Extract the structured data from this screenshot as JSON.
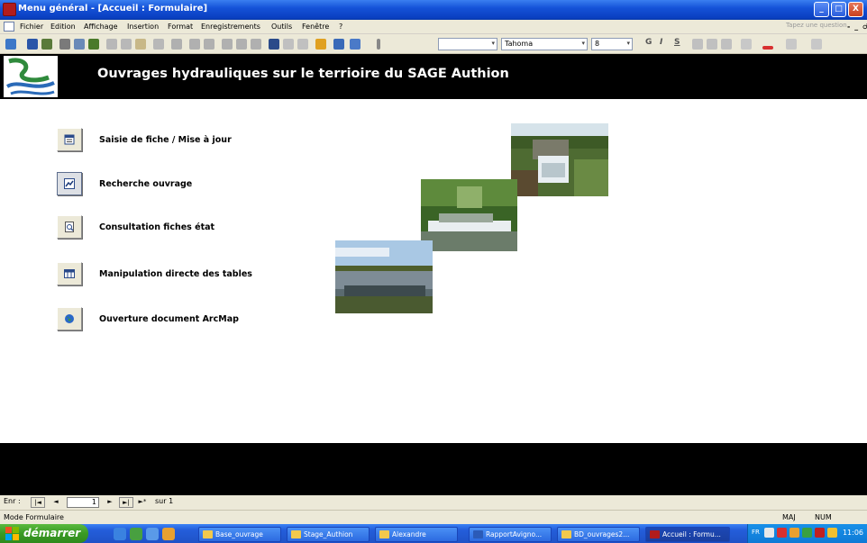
{
  "window": {
    "title": "Menu général - [Accueil : Formulaire]",
    "controls": [
      "_",
      "□",
      "X"
    ]
  },
  "menubar": {
    "items": [
      "Fichier",
      "Edition",
      "Affichage",
      "Insertion",
      "Format",
      "Enregistrements",
      "Outils",
      "Fenêtre",
      "?"
    ],
    "help_placeholder": "Tapez une question",
    "doc_controls": "- _ ♂ x"
  },
  "toolbar": {
    "font_name": "Tahoma",
    "font_size": "8",
    "bold": "G",
    "italic": "I",
    "underline": "S"
  },
  "header": {
    "title": "Ouvrages hydrauliques sur le terrioire du SAGE Authion",
    "logo_text": "SAGE Authion"
  },
  "form": {
    "buttons": [
      {
        "label": "Saisie de fiche / Mise à jour",
        "icon": "form-icon"
      },
      {
        "label": "Recherche ouvrage",
        "icon": "search-chart-icon"
      },
      {
        "label": "Consultation fiches état",
        "icon": "report-preview-icon"
      },
      {
        "label": "Manipulation directe des tables",
        "icon": "table-icon"
      },
      {
        "label": "Ouverture document ArcMap",
        "icon": "globe-icon"
      }
    ],
    "photos": [
      {
        "description": "weir-photo-1",
        "palette": [
          "#5d7a3a",
          "#d9e6ee",
          "#3d4e2a"
        ]
      },
      {
        "description": "weir-photo-2",
        "palette": [
          "#3e6a2a",
          "#e8eef0",
          "#6a8a48"
        ]
      },
      {
        "description": "weir-photo-3",
        "palette": [
          "#a6c6e2",
          "#54612e",
          "#6d7d86"
        ]
      }
    ]
  },
  "navigator": {
    "label": "Enr :",
    "first": "|◄",
    "prev": "◄",
    "current": "1",
    "next": "►",
    "last": "►|",
    "new": "►*",
    "total": "sur 1"
  },
  "statusbar": {
    "mode": "Mode Formulaire",
    "caps": "MAJ",
    "num": "NUM"
  },
  "taskbar": {
    "start_label": "démarrer",
    "tasks": [
      "Base_ouvrage",
      "Stage_Authion",
      "Alexandre",
      "RapportAvigno...",
      "BD_ouvrages2...",
      "Accueil : Formu..."
    ],
    "language": "FR",
    "clock": "11:06"
  }
}
